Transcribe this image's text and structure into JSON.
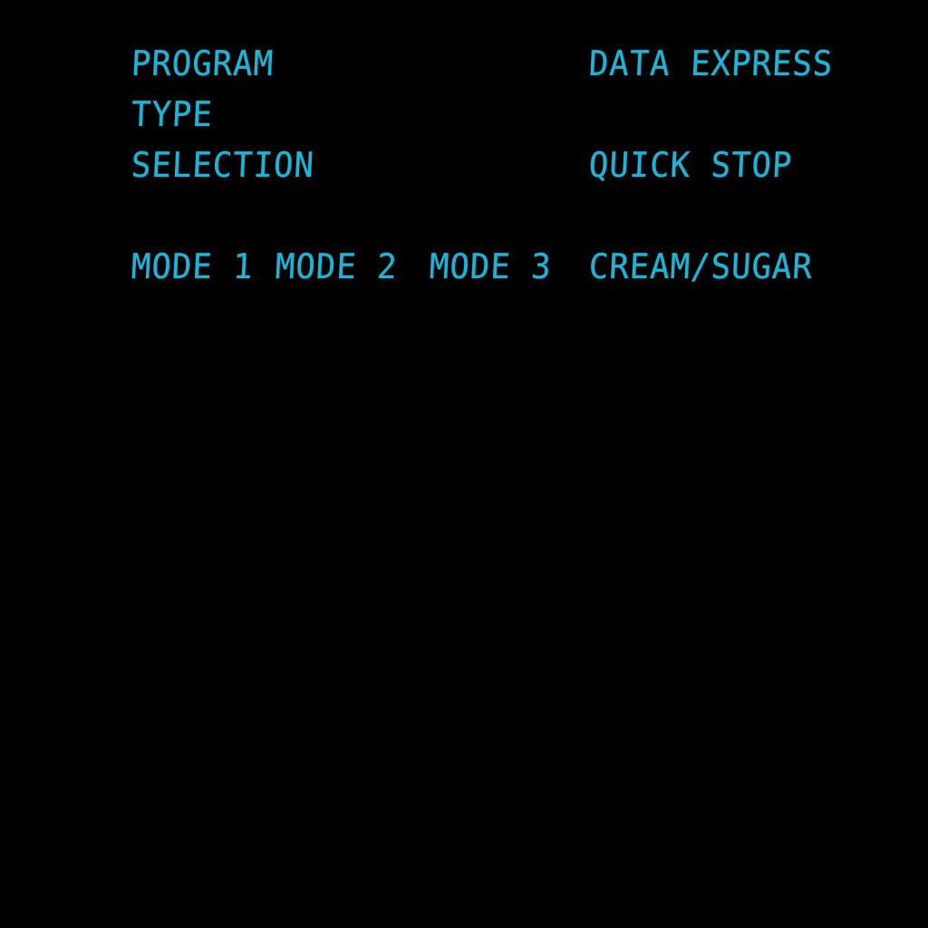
{
  "theme": {
    "background": "#000000",
    "lcd_color": "#1fb4d6"
  },
  "left_labels": {
    "program": "PROGRAM",
    "type": "TYPE",
    "selection": "SELECTION"
  },
  "right_labels": {
    "data_express": "DATA EXPRESS",
    "quick_stop": "QUICK STOP",
    "cream_sugar": "CREAM/SUGAR"
  },
  "modes": {
    "mode1": "MODE 1",
    "mode2": "MODE 2",
    "mode3": "MODE 3"
  }
}
